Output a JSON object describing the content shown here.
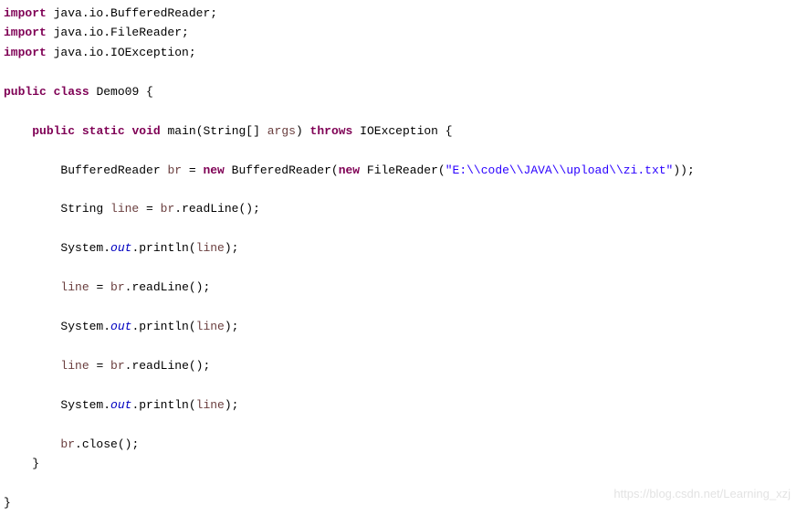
{
  "code": {
    "kw_import": "import",
    "imp1": " java.io.BufferedReader;",
    "imp2": " java.io.FileReader;",
    "imp3": " java.io.IOException;",
    "kw_public": "public",
    "kw_class": "class",
    "class_name": " Demo09 {",
    "kw_static": "static",
    "kw_void": "void",
    "main_sig1": " main(String[] ",
    "args": "args",
    "main_sig2": ") ",
    "kw_throws": "throws",
    "throws_rest": " IOException {",
    "l1a": "        BufferedReader ",
    "br": "br",
    "l1b": " = ",
    "kw_new": "new",
    "l1c": " BufferedReader(",
    "l1d": " FileReader(",
    "file_str": "\"E:\\\\code\\\\JAVA\\\\upload\\\\zi.txt\"",
    "l1e": "));",
    "l2a": "        String ",
    "line": "line",
    "l2b": " = ",
    "l2c": ".readLine();",
    "l3a": "        System.",
    "out": "out",
    "l3b": ".println(",
    "l3c": ");",
    "l4a": "        ",
    "l4b": " = ",
    "l4c": ".readLine();",
    "l_close": "        ",
    "close_rest": ".close();",
    "brace_close_inner": "    }",
    "brace_close_outer": "}"
  },
  "watermark": "https://blog.csdn.net/Learning_xzj"
}
